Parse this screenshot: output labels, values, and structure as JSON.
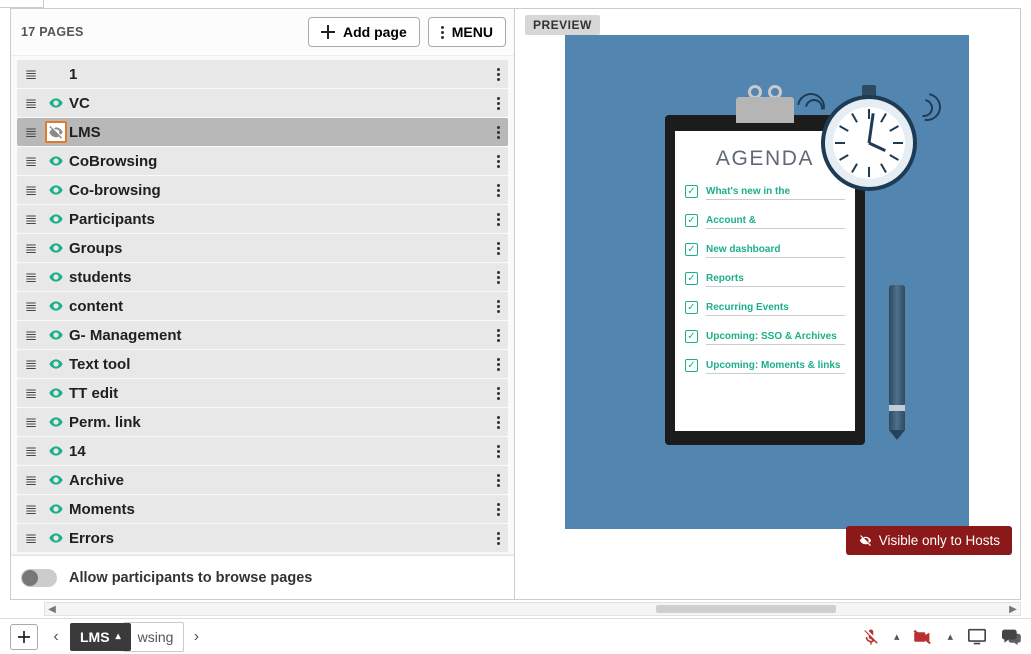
{
  "header": {
    "pages_label": "17 PAGES",
    "add_page_label": "Add page",
    "menu_label": "MENU"
  },
  "pages": [
    {
      "name": "1",
      "visible": true,
      "selected": false,
      "has_vis_icon": false
    },
    {
      "name": "VC",
      "visible": true,
      "selected": false,
      "has_vis_icon": true
    },
    {
      "name": "LMS",
      "visible": false,
      "selected": true,
      "has_vis_icon": true
    },
    {
      "name": "CoBrowsing",
      "visible": true,
      "selected": false,
      "has_vis_icon": true
    },
    {
      "name": "Co-browsing",
      "visible": true,
      "selected": false,
      "has_vis_icon": true
    },
    {
      "name": "Participants",
      "visible": true,
      "selected": false,
      "has_vis_icon": true
    },
    {
      "name": "Groups",
      "visible": true,
      "selected": false,
      "has_vis_icon": true
    },
    {
      "name": "students",
      "visible": true,
      "selected": false,
      "has_vis_icon": true
    },
    {
      "name": "content",
      "visible": true,
      "selected": false,
      "has_vis_icon": true
    },
    {
      "name": "G- Management",
      "visible": true,
      "selected": false,
      "has_vis_icon": true
    },
    {
      "name": "Text tool",
      "visible": true,
      "selected": false,
      "has_vis_icon": true
    },
    {
      "name": "TT edit",
      "visible": true,
      "selected": false,
      "has_vis_icon": true
    },
    {
      "name": "Perm. link",
      "visible": true,
      "selected": false,
      "has_vis_icon": true
    },
    {
      "name": "14",
      "visible": true,
      "selected": false,
      "has_vis_icon": true
    },
    {
      "name": "Archive",
      "visible": true,
      "selected": false,
      "has_vis_icon": true
    },
    {
      "name": "Moments",
      "visible": true,
      "selected": false,
      "has_vis_icon": true
    },
    {
      "name": "Errors",
      "visible": true,
      "selected": false,
      "has_vis_icon": true
    }
  ],
  "footer": {
    "browse_label": "Allow participants to browse pages",
    "browse_enabled": false
  },
  "preview": {
    "badge": "PREVIEW",
    "agenda_title": "AGENDA",
    "hosts_badge": "Visible only to Hosts",
    "items": [
      "What's new in the",
      "Account &",
      "New dashboard",
      "Reports",
      "Recurring Events",
      "Upcoming: SSO & Archives",
      "Upcoming: Moments & links"
    ]
  },
  "bottom": {
    "current_tab": "LMS",
    "behind_tab": "wsing"
  },
  "colors": {
    "accent_green": "#1baf8a",
    "preview_bg": "#5285b0",
    "danger": "#b83030",
    "highlight_box": "#e07b2a",
    "hosts_bg": "#8c1919"
  }
}
